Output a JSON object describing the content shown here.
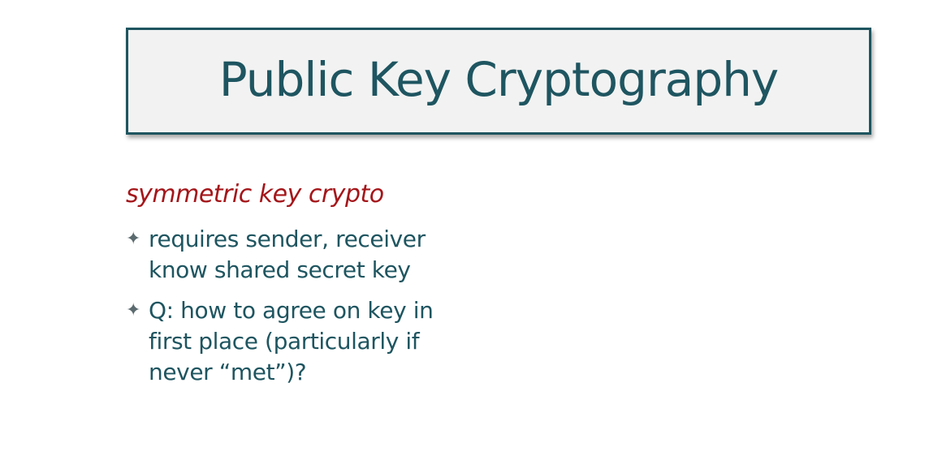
{
  "slide": {
    "title": "Public Key Cryptography",
    "subheading": "symmetric key crypto",
    "bullets": [
      {
        "icon": "four-pointed-star-icon",
        "text": "requires sender, receiver\nknow shared secret key"
      },
      {
        "icon": "four-pointed-star-icon",
        "text": "Q: how to agree on key in\nfirst place (particularly if\nnever “met”)?"
      }
    ]
  },
  "colors": {
    "title_text": "#1e5560",
    "title_border": "#1e5560",
    "title_background": "#f2f2f2",
    "subheading": "#a4161a",
    "body_text": "#1e5560"
  }
}
